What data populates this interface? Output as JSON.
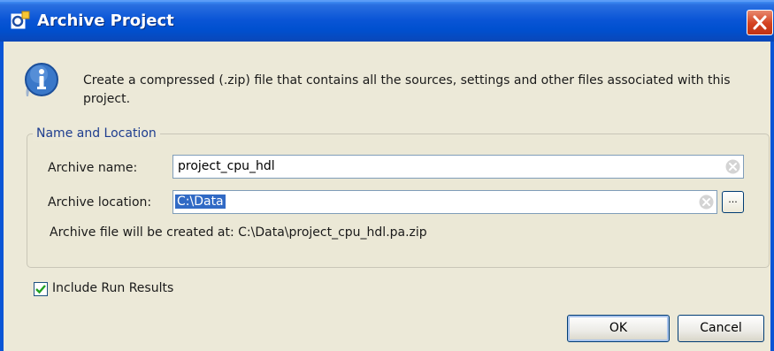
{
  "window": {
    "title": "Archive Project"
  },
  "info": {
    "text": "Create a compressed (.zip) file that contains all the sources, settings and other files associated with this project."
  },
  "group": {
    "label": "Name and Location",
    "archive_name_label": "Archive name:",
    "archive_name_value": "project_cpu_hdl",
    "archive_location_label": "Archive location:",
    "archive_location_value": "C:\\Data",
    "browse_label": "...",
    "status_text": "Archive file will be created at: C:\\Data\\project_cpu_hdl.pa.zip"
  },
  "options": {
    "include_run_results_label": "Include Run Results",
    "include_run_results_checked": true
  },
  "buttons": {
    "ok_label": "OK",
    "cancel_label": "Cancel"
  },
  "colors": {
    "titlebar": "#0a55d6",
    "selection": "#316ac5",
    "group_label": "#1e3d8f",
    "close": "#d3411f"
  },
  "icons": {
    "app": "project-app-icon",
    "info": "info-icon",
    "close": "close-icon",
    "clear": "clear-field-icon",
    "check": "checkmark-icon"
  }
}
